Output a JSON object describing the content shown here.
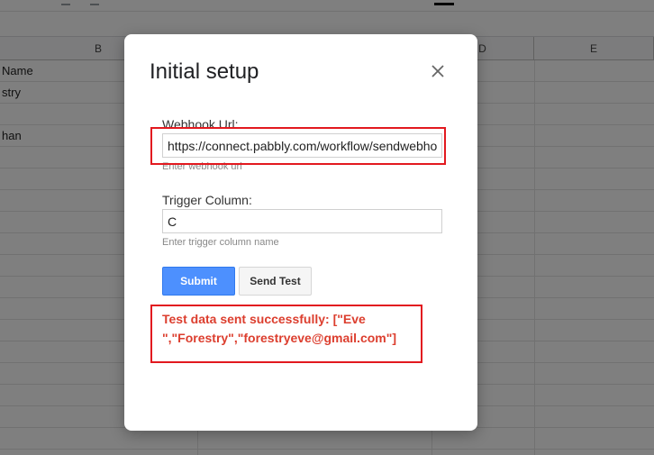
{
  "sheet": {
    "columns": [
      "B",
      "D",
      "E"
    ],
    "cells": [
      "Name",
      "stry",
      "han"
    ]
  },
  "dialog": {
    "title": "Initial setup",
    "webhook": {
      "label": "Webhook Url:",
      "value": "https://connect.pabbly.com/workflow/sendwebhookdata",
      "hint": "Enter webhook url"
    },
    "trigger": {
      "label": "Trigger Column:",
      "value": "C",
      "hint": "Enter trigger column name"
    },
    "buttons": {
      "submit": "Submit",
      "send_test": "Send Test"
    },
    "status": "Test data sent successfully: [\"Eve \",\"Forestry\",\"forestryeve@gmail.com\"]"
  },
  "colors": {
    "accent": "#4d90fe",
    "highlight_box": "#e2191f",
    "status_text": "#dc3e2e"
  }
}
